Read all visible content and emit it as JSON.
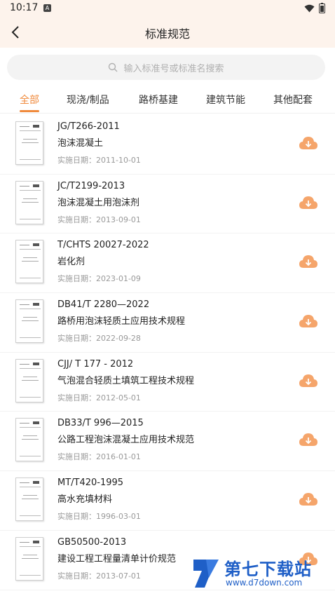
{
  "status_bar": {
    "time": "10:17",
    "notification_glyph": "A"
  },
  "nav": {
    "title": "标准规范"
  },
  "search": {
    "placeholder": "输入标准号或标准名搜索"
  },
  "tabs": [
    {
      "label": "全部",
      "active": true
    },
    {
      "label": "现浇/制品",
      "active": false
    },
    {
      "label": "路桥基建",
      "active": false
    },
    {
      "label": "建筑节能",
      "active": false
    },
    {
      "label": "其他配套",
      "active": false
    }
  ],
  "date_prefix": "实施日期：",
  "standards": [
    {
      "code": "JG/T266-2011",
      "name": "泡沫混凝土",
      "date": "2011-10-01"
    },
    {
      "code": "JC/T2199-2013",
      "name": "泡沫混凝土用泡沫剂",
      "date": "2013-09-01"
    },
    {
      "code": "T/CHTS 20027-2022",
      "name": "岩化剂",
      "date": "2023-01-09"
    },
    {
      "code": "DB41/T 2280—2022",
      "name": "路桥用泡沫轻质土应用技术规程",
      "date": "2022-09-28"
    },
    {
      "code": "CJJ/ T 177 - 2012",
      "name": "气泡混合轻质土填筑工程技术规程",
      "date": "2012-05-01"
    },
    {
      "code": "DB33/T 996—2015",
      "name": "公路工程泡沫混凝土应用技术规范",
      "date": "2016-01-01"
    },
    {
      "code": "MT/T420-1995",
      "name": "高水充填材料",
      "date": "1996-03-01"
    },
    {
      "code": "GB50500-2013",
      "name": "建设工程工程量清单计价规范",
      "date": "2013-07-01"
    }
  ],
  "watermark": {
    "title": "第七下载站",
    "url": "www.d7down.com"
  },
  "colors": {
    "accent": "#f08a3c",
    "header_bg": "#fdf3ec",
    "watermark": "#1f5fc7"
  },
  "icons": {
    "back": "chevron-left-icon",
    "search": "search-icon",
    "download": "cloud-download-icon"
  }
}
